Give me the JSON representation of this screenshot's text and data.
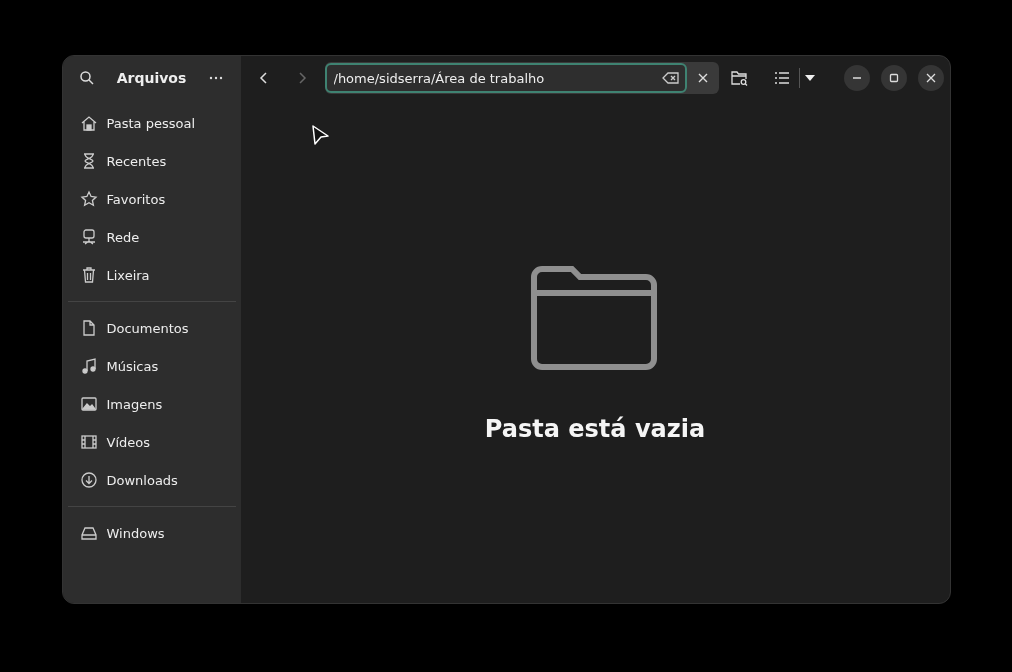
{
  "sidebar": {
    "title": "Arquivos",
    "sections": [
      [
        {
          "label": "Pasta pessoal",
          "kind": "home"
        },
        {
          "label": "Recentes",
          "kind": "recent"
        },
        {
          "label": "Favoritos",
          "kind": "star"
        },
        {
          "label": "Rede",
          "kind": "network"
        },
        {
          "label": "Lixeira",
          "kind": "trash"
        }
      ],
      [
        {
          "label": "Documentos",
          "kind": "document"
        },
        {
          "label": "Músicas",
          "kind": "music"
        },
        {
          "label": "Imagens",
          "kind": "image"
        },
        {
          "label": "Vídeos",
          "kind": "video"
        },
        {
          "label": "Downloads",
          "kind": "download"
        }
      ],
      [
        {
          "label": "Windows",
          "kind": "drive"
        }
      ]
    ]
  },
  "nav": {
    "back_disabled": false,
    "forward_disabled": true
  },
  "location": {
    "value": "/home/sidserra/Área de trabalho"
  },
  "empty_state": {
    "message": "Pasta está vazia"
  }
}
